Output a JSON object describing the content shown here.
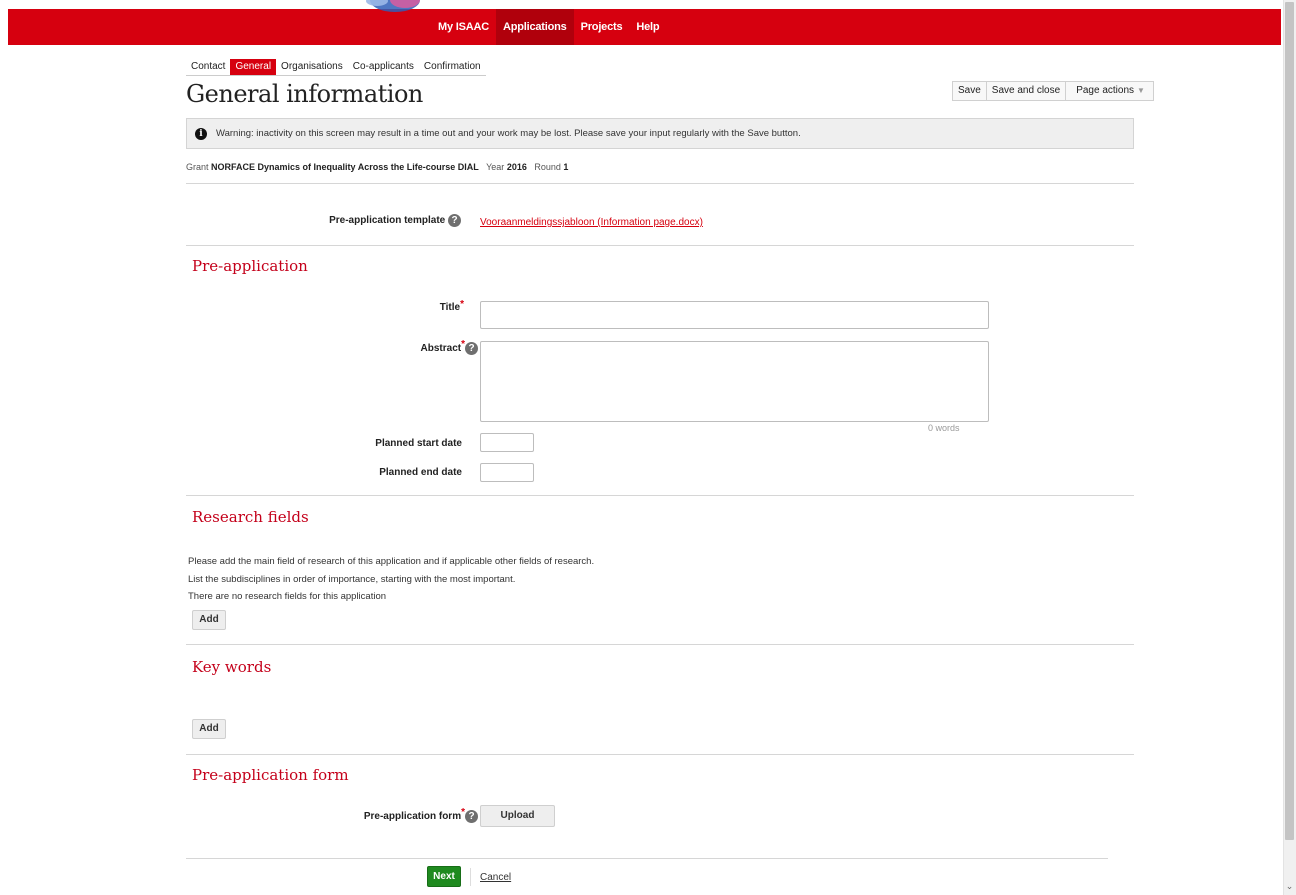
{
  "topnav": {
    "items": [
      "My ISAAC",
      "Applications",
      "Projects",
      "Help"
    ],
    "active_index": 1
  },
  "subnav": {
    "tabs": [
      "Contact",
      "General",
      "Organisations",
      "Co-applicants",
      "Confirmation"
    ],
    "active_index": 1
  },
  "page": {
    "title": "General information"
  },
  "actions": {
    "save": "Save",
    "save_close": "Save and close",
    "page_actions": "Page actions"
  },
  "warning": {
    "text": "Warning: inactivity on this screen may result in a time out and your work may be lost. Please save your input regularly with the Save button."
  },
  "grant": {
    "grant_label": "Grant",
    "grant_value": "NORFACE Dynamics of Inequality Across the Life-course DIAL",
    "year_label": "Year",
    "year_value": "2016",
    "round_label": "Round",
    "round_value": "1"
  },
  "template": {
    "label": "Pre-application template",
    "link": "Vooraanmeldingssjabloon (Information page.docx)"
  },
  "pre_application": {
    "heading": "Pre-application",
    "title_label": "Title",
    "title_value": "",
    "abstract_label": "Abstract",
    "abstract_value": "",
    "word_count": "0 words",
    "start_label": "Planned start date",
    "start_value": "",
    "end_label": "Planned end date",
    "end_value": ""
  },
  "research_fields": {
    "heading": "Research fields",
    "line1": "Please add the main field of research of this application and if applicable other fields of research.",
    "line2": "List the subdisciplines in order of importance, starting with the most important.",
    "line3": "There are no research fields for this application",
    "add": "Add"
  },
  "key_words": {
    "heading": "Key words",
    "add": "Add"
  },
  "form": {
    "heading": "Pre-application form",
    "label": "Pre-application form",
    "upload": "Upload"
  },
  "footer": {
    "next": "Next",
    "cancel": "Cancel"
  },
  "colors": {
    "brand_red": "#d6000f",
    "next_green": "#1f8a1f"
  }
}
